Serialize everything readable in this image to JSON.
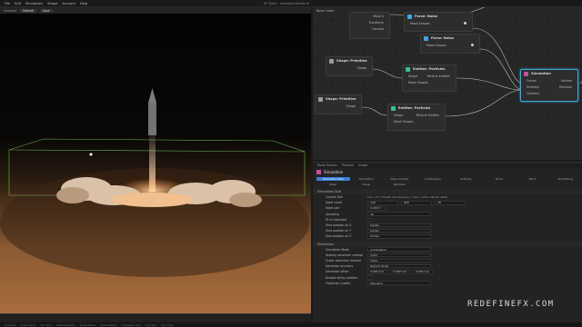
{
  "menu": [
    "File",
    "Edit",
    "Simulation",
    "Shape",
    "Account",
    "Help"
  ],
  "window_title": "EF Dash - Assets/Untitled.ef",
  "toolbar": {
    "view": "Viewport",
    "mode": "Default",
    "save": "Save"
  },
  "graph": {
    "tab": "Node Graph",
    "nodes": [
      {
        "title": "",
        "rows": [
          "Mask 4",
          "Transform",
          "Camera"
        ]
      },
      {
        "title": "Force: Noise",
        "rows": [
          "Mask Shapes"
        ]
      },
      {
        "title": "Force: Noise",
        "rows": [
          "Mask Shapes"
        ]
      },
      {
        "title": "Shape: Primitive",
        "rows": [
          "Shape"
        ]
      },
      {
        "title": "Emitter: Particles",
        "rows": [
          "Shape",
          "Mask Shapes"
        ],
        "out": "Particle Emitter"
      },
      {
        "title": "Shape: Primitive",
        "rows": [
          "Shape"
        ]
      },
      {
        "title": "Emitter: Particles",
        "rows": [
          "Shape",
          "Mask Shapes"
        ],
        "out": "Particle Emitter"
      },
      {
        "title": "Simulation",
        "rows": [
          "Forces",
          "Emitters",
          "Colliders"
        ],
        "outs": [
          "Volume",
          "Particles"
        ]
      }
    ]
  },
  "props": {
    "tabs": [
      "Node Details",
      "Preview",
      "Graph"
    ],
    "title": "Simulation",
    "subtabs": [
      "Simulation Size",
      "Simulation",
      "View Content",
      "Combustion",
      "Vorticity",
      "Force",
      "Wind",
      "Smoothing"
    ],
    "subtabs2": [
      "Mesh",
      "Visual",
      "Particles"
    ],
    "sections": [
      {
        "name": "Simulation Size",
        "rows": [
          {
            "label": "Current Size",
            "value": "128 x 172 x 56 with Grid Upscaling = 1024 x 1376 x 448 (8x detail)"
          },
          {
            "label": "Voxel count",
            "v": [
              "128",
              "400",
              "78"
            ]
          },
          {
            "label": "Voxel size",
            "v": [
              "0.000 m"
            ]
          },
          {
            "label": "Upscaling",
            "v": [
              "x8"
            ]
          },
          {
            "label": "Fit to Upscaled",
            "v": [
              ""
            ]
          },
          {
            "label": "Zero position on X",
            "v": [
              "Center"
            ]
          },
          {
            "label": "Zero position on Y",
            "v": [
              "Center"
            ]
          },
          {
            "label": "Zero position on Z",
            "v": [
              "Center"
            ]
          }
        ]
      },
      {
        "name": "Simulation",
        "rows": [
          {
            "label": "Simulation Mode",
            "v": [
              "Combustion"
            ]
          },
          {
            "label": "Velocity advection method",
            "v": [
              "Cubic"
            ]
          },
          {
            "label": "Scalar advection method",
            "v": [
              "Cubic"
            ]
          },
          {
            "label": "Advection accuracy",
            "v": [
              "Second Order"
            ]
          },
          {
            "label": "Advection offset",
            "v": [
              "0.000 m/s",
              "0.000 m/s",
              "0.000 m/s"
            ]
          },
          {
            "label": "Disable sticky colliders",
            "v": [
              ""
            ]
          },
          {
            "label": "Projection Quality",
            "v": [
              "Standard"
            ]
          }
        ]
      }
    ]
  },
  "status": [
    "Grid Size",
    "Voxel Count",
    "Sim Time",
    "Total Elements",
    "Scene Name",
    "Node Details",
    "Simulation Size",
    "Grid Size",
    "Sim Time"
  ],
  "watermark": "REDEFINEFX.COM"
}
